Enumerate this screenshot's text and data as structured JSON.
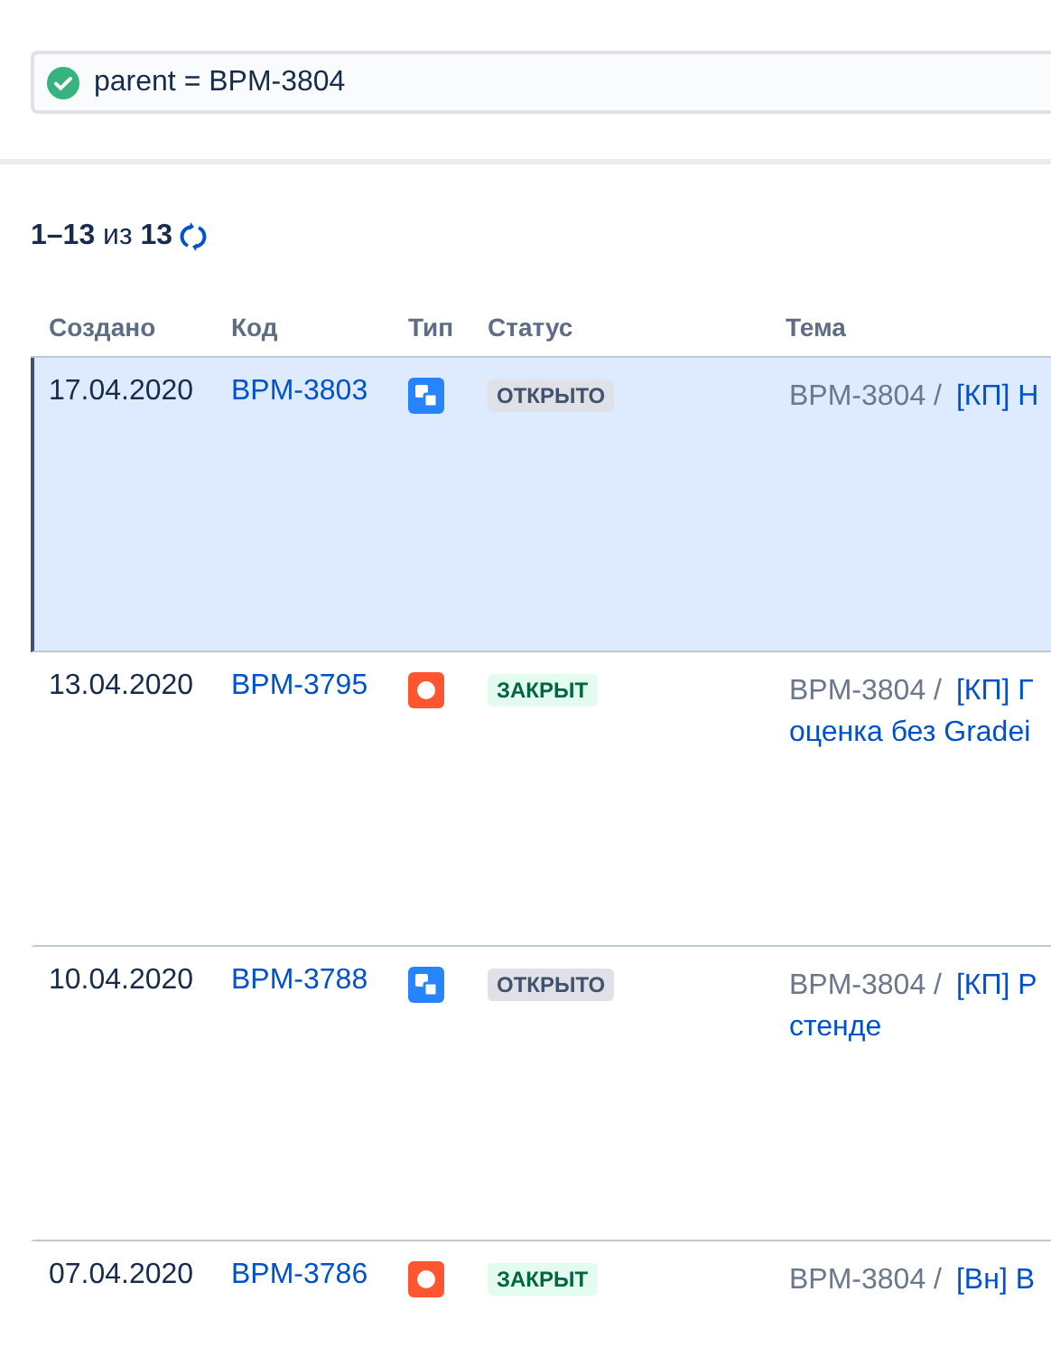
{
  "filter": {
    "query": "parent = BPM-3804",
    "valid": true
  },
  "pagination": "**1–13** из **13**",
  "table": {
    "columns": [
      "Создано",
      "Код",
      "Тип",
      "Статус",
      "Тема"
    ],
    "rows": [
      {
        "created": "17.04.2020",
        "key": "BPM-3803",
        "kind": "subtask",
        "status": {
          "label": "ОТКРЫТО",
          "kind": "open"
        },
        "parent": "BPM-3804 /",
        "title_lines": [
          "[КП] Н"
        ],
        "selected": true
      },
      {
        "created": "13.04.2020",
        "key": "BPM-3795",
        "kind": "bug",
        "status": {
          "label": "ЗАКРЫТ",
          "kind": "done"
        },
        "parent": "BPM-3804 /",
        "title_lines": [
          "[КП] Г",
          "оценка без Gradei"
        ],
        "selected": false
      },
      {
        "created": "10.04.2020",
        "key": "BPM-3788",
        "kind": "subtask",
        "status": {
          "label": "ОТКРЫТО",
          "kind": "open"
        },
        "parent": "BPM-3804 /",
        "title_lines": [
          "[КП] Р",
          "стенде"
        ],
        "selected": false
      },
      {
        "created": "07.04.2020",
        "key": "BPM-3786",
        "kind": "bug",
        "status": {
          "label": "ЗАКРЫТ",
          "kind": "done"
        },
        "parent": "BPM-3804 /",
        "title_lines": [
          "[Вн] В"
        ],
        "selected": false
      }
    ]
  }
}
